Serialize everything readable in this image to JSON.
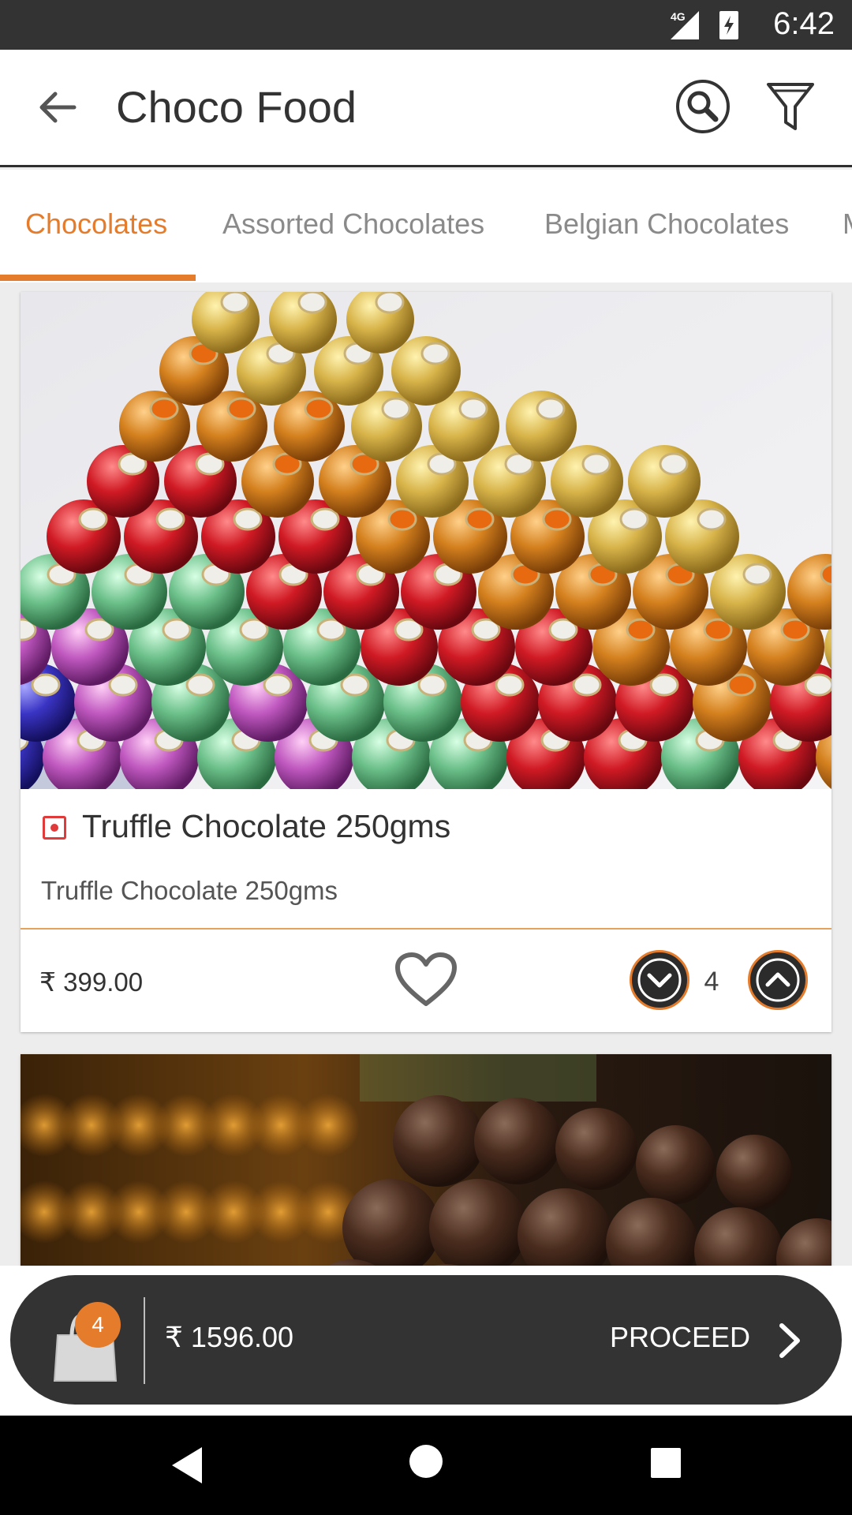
{
  "status_bar": {
    "time": "6:42",
    "network": "4G",
    "icons": [
      "signal-icon",
      "battery-charging-icon"
    ]
  },
  "app_bar": {
    "title": "Choco Food",
    "icons": [
      "back-arrow-icon",
      "search-icon",
      "filter-icon"
    ]
  },
  "tabs": [
    {
      "label": "Chocolates",
      "active": true
    },
    {
      "label": "Assorted Chocolates",
      "active": false
    },
    {
      "label": "Belgian Chocolates",
      "active": false
    },
    {
      "label": "M",
      "active": false
    }
  ],
  "products": [
    {
      "title": "Truffle Chocolate 250gms",
      "description": "Truffle Chocolate 250gms",
      "price": "₹ 399.00",
      "quantity": "4",
      "favorite": false
    }
  ],
  "cart": {
    "count": "4",
    "total": "₹ 1596.00",
    "proceed_label": "PROCEED"
  },
  "colors": {
    "accent": "#e57c2c",
    "dark": "#333333",
    "veg_mark": "#e03a3a"
  }
}
